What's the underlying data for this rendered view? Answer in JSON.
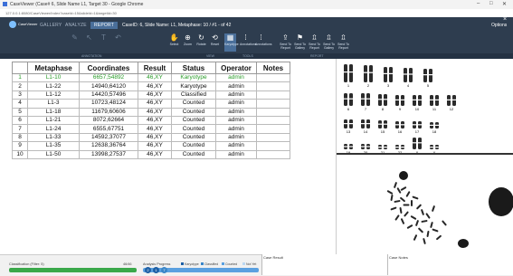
{
  "window": {
    "title": "CaseViewer (Case# 6, Slide Name L1, Target 30 - Google Chrome",
    "url": "127.0.0.1:8080/CaseViewer/Index?caseId=15&slideId=1&targetId=30",
    "controls": [
      "–",
      "□",
      "✕"
    ]
  },
  "ribbon": {
    "logo_text": "CaseViewer",
    "tabs": [
      "GALLERY",
      "ANALYZE",
      "REPORT"
    ],
    "active_tab": "REPORT",
    "case_info": "CaseID: 6, Slide Name: L1, Metaphase: 10 / #1 - of 42",
    "options_label": "Options",
    "tools": [
      "Select",
      "Zoom",
      "Rotate",
      "Reset",
      "Karyotype",
      "Annotations",
      "Annotations",
      "Send To Report",
      "Send To Gallery",
      "Send To Report",
      "Send To Gallery",
      "Send To Report"
    ],
    "sections": [
      "ANNOTATION",
      "VIEW",
      "TOOLS",
      "REPORT"
    ]
  },
  "table": {
    "headers": [
      "",
      "Metaphase",
      "Coordinates",
      "Result",
      "Status",
      "Operator",
      "Notes"
    ],
    "rows": [
      {
        "n": "1",
        "metaphase": "L1-10",
        "coordinates": "6657,54892",
        "result": "46,XY",
        "status": "Karyotype",
        "operator": "admin",
        "notes": ""
      },
      {
        "n": "2",
        "metaphase": "L1-22",
        "coordinates": "14940,64120",
        "result": "46,XY",
        "status": "Karyotype",
        "operator": "admin",
        "notes": ""
      },
      {
        "n": "3",
        "metaphase": "L1-12",
        "coordinates": "14420,57496",
        "result": "46,XY",
        "status": "Classified",
        "operator": "admin",
        "notes": ""
      },
      {
        "n": "4",
        "metaphase": "L1-3",
        "coordinates": "10723,48124",
        "result": "46,XY",
        "status": "Counted",
        "operator": "admin",
        "notes": ""
      },
      {
        "n": "5",
        "metaphase": "L1-18",
        "coordinates": "11679,60606",
        "result": "46,XY",
        "status": "Counted",
        "operator": "admin",
        "notes": ""
      },
      {
        "n": "6",
        "metaphase": "L1-21",
        "coordinates": "8072,62664",
        "result": "46,XY",
        "status": "Counted",
        "operator": "admin",
        "notes": ""
      },
      {
        "n": "7",
        "metaphase": "L1-24",
        "coordinates": "6555,67751",
        "result": "46,XY",
        "status": "Counted",
        "operator": "admin",
        "notes": ""
      },
      {
        "n": "8",
        "metaphase": "L1-33",
        "coordinates": "14592,37077",
        "result": "46,XY",
        "status": "Counted",
        "operator": "admin",
        "notes": ""
      },
      {
        "n": "9",
        "metaphase": "L1-35",
        "coordinates": "12638,36764",
        "result": "46,XY",
        "status": "Counted",
        "operator": "admin",
        "notes": ""
      },
      {
        "n": "10",
        "metaphase": "L1-50",
        "coordinates": "13998,27537",
        "result": "46,XY",
        "status": "Counted",
        "operator": "admin",
        "notes": ""
      }
    ]
  },
  "karyogram": {
    "row1": [
      "1",
      "2",
      "3",
      "4",
      "5"
    ],
    "row2": [
      "6",
      "7",
      "8",
      "9",
      "10",
      "11",
      "12"
    ],
    "row3": [
      "13",
      "14",
      "15",
      "16",
      "17",
      "18"
    ],
    "row4": [
      "19",
      "20",
      "21",
      "22",
      "X",
      "Y"
    ]
  },
  "bottom": {
    "classification_label": "Classification (Filter: 5)",
    "classification_count": "46/46",
    "analysis_label": "Analysis Progress",
    "legend": [
      "Karyotype",
      "Classified",
      "Counted",
      "Not Yet"
    ],
    "progress_markers": [
      "2",
      "1",
      "7"
    ],
    "case_result_label": "Case Result",
    "case_notes_label": "Case Notes"
  },
  "colors": {
    "ribbon": "#2e3d4f",
    "selected_row_text": "#2a9c2a",
    "progress_green": "#3aa84a",
    "progress_blue": "#5aa0e0"
  }
}
